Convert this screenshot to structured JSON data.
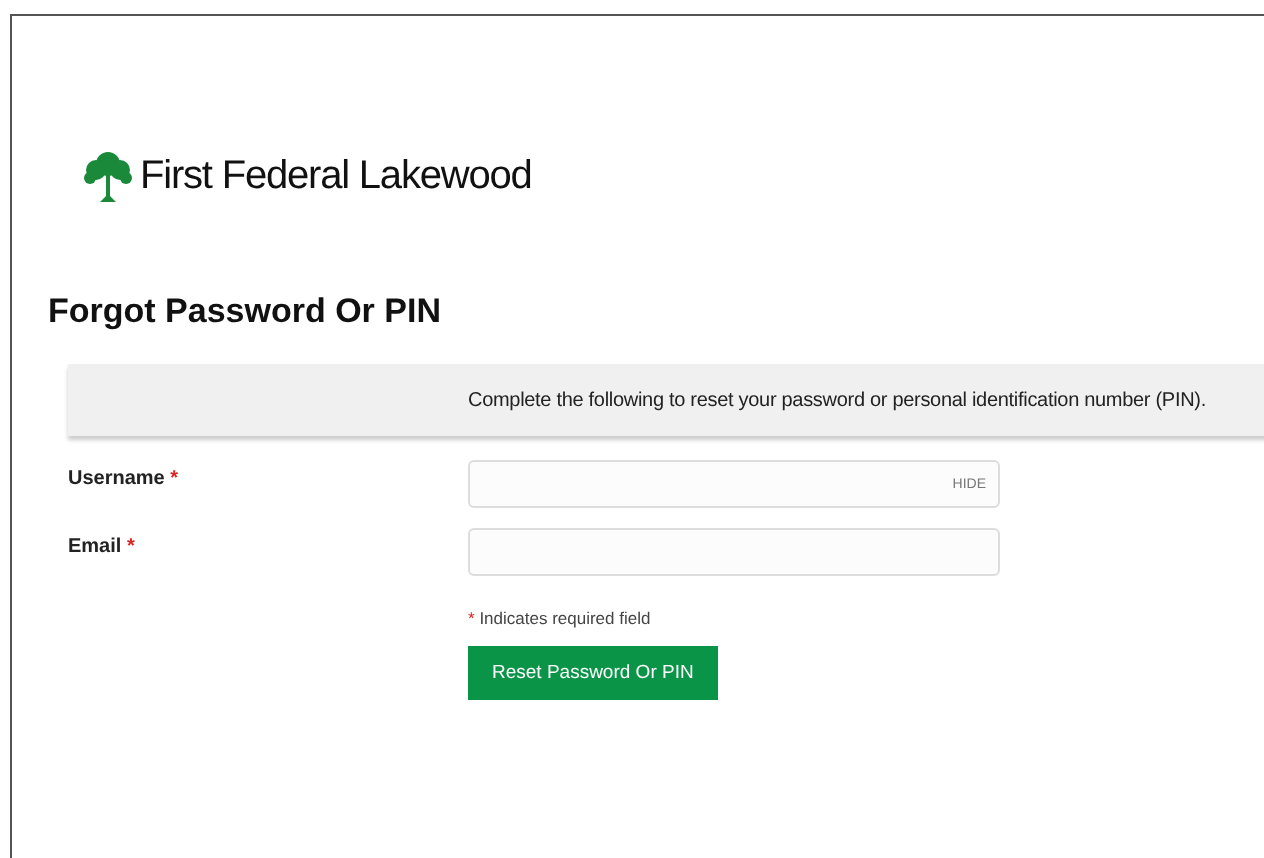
{
  "brand": {
    "name": "First Federal Lakewood"
  },
  "title": "Forgot Password Or PIN",
  "instructions": "Complete the following to reset your password or personal identification number (PIN).",
  "fields": [
    {
      "label": "Username",
      "required_mark": "*",
      "toggle": "HIDE"
    },
    {
      "label": "Email",
      "required_mark": "*"
    }
  ],
  "required_note": {
    "mark": "*",
    "text": "Indicates required field"
  },
  "submit": "Reset Password Or PIN"
}
